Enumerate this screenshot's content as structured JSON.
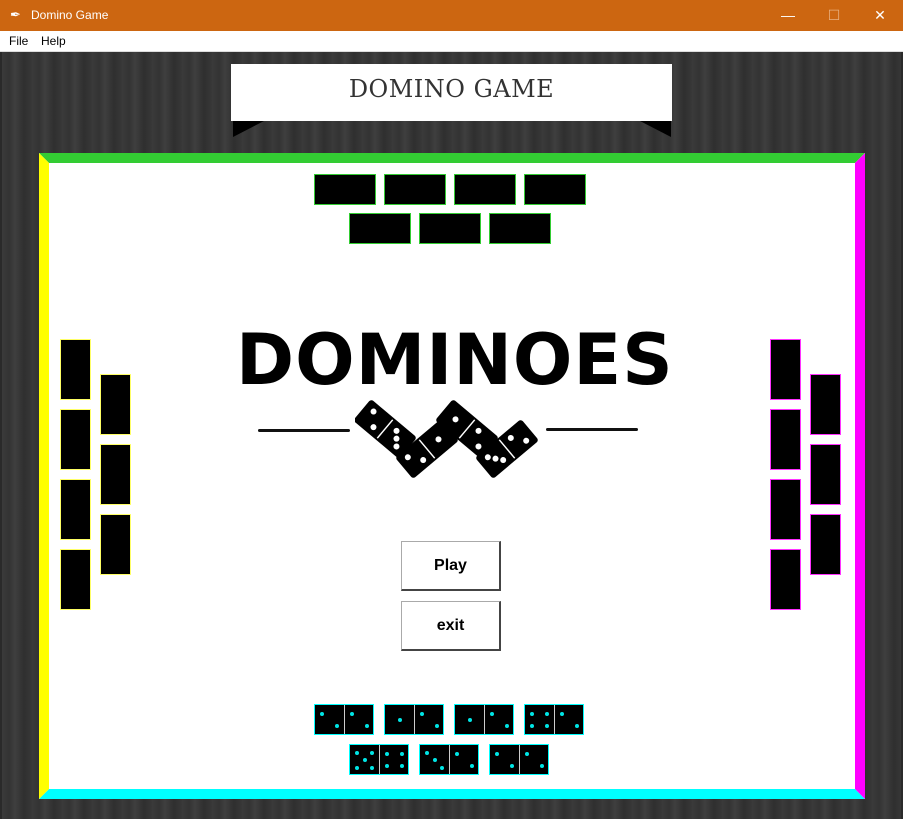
{
  "window": {
    "title": "Domino Game",
    "app_icon": "feather-icon",
    "controls": {
      "minimize": "—",
      "maximize": "☐",
      "close": "✕"
    }
  },
  "menu": {
    "file": "File",
    "help": "Help"
  },
  "banner": {
    "title": "DOMINO GAME"
  },
  "logo": {
    "text": "DOMINOES"
  },
  "buttons": {
    "play": "Play",
    "exit": "exit"
  },
  "colors": {
    "top_player": "#33cc33",
    "left_player": "#ffff00",
    "right_player": "#ff00ff",
    "bottom_player": "#00ffff",
    "titlebar": "#cc6611"
  },
  "players": {
    "top": {
      "tile_count": 7,
      "face": "down"
    },
    "left": {
      "tile_count": 7,
      "face": "down"
    },
    "right": {
      "tile_count": 7,
      "face": "down"
    },
    "bottom": {
      "tile_count": 7,
      "face": "up",
      "tiles": [
        [
          2,
          2
        ],
        [
          1,
          2
        ],
        [
          1,
          2
        ],
        [
          4,
          2
        ],
        [
          5,
          4
        ],
        [
          3,
          2
        ],
        [
          2,
          2
        ]
      ]
    }
  }
}
